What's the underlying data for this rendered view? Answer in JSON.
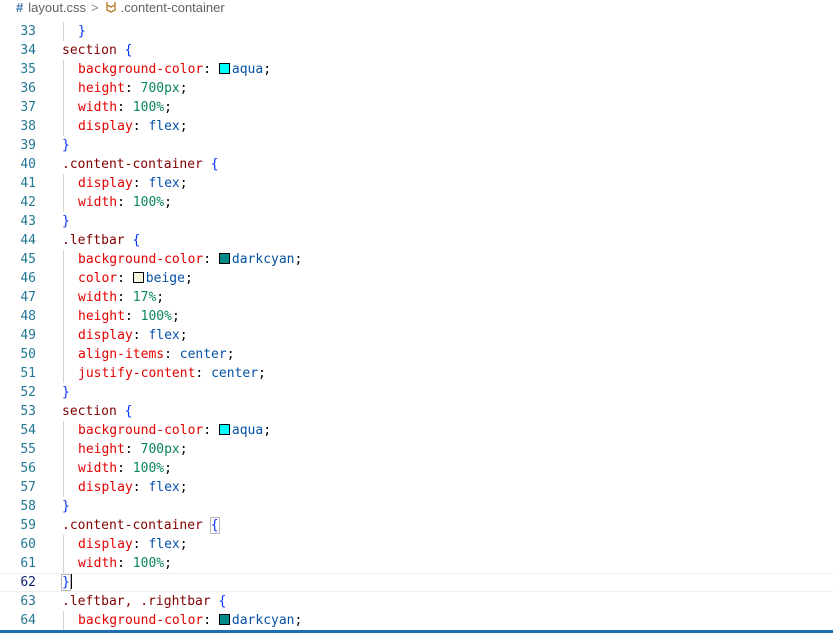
{
  "breadcrumb": {
    "file_icon": "#",
    "file_name": "layout.css",
    "separator": ">",
    "selector_icon": "css-selector-icon",
    "selector": ".content-container"
  },
  "editor": {
    "current_line": "62",
    "lines": [
      {
        "num": "33",
        "tokens": [
          {
            "t": "}",
            "c": "brace"
          }
        ],
        "indent": 1
      },
      {
        "num": "34",
        "tokens": [
          {
            "t": "section",
            "c": "sel"
          },
          {
            "t": " ",
            "c": "punct"
          },
          {
            "t": "{",
            "c": "brace"
          }
        ],
        "indent": 0
      },
      {
        "num": "35",
        "tokens": [
          {
            "t": "background-color",
            "c": "prop"
          },
          {
            "t": ": ",
            "c": "punct"
          },
          {
            "swatch": "#00ffff"
          },
          {
            "t": "aqua",
            "c": "val"
          },
          {
            "t": ";",
            "c": "punct"
          }
        ],
        "indent": 1
      },
      {
        "num": "36",
        "tokens": [
          {
            "t": "height",
            "c": "prop"
          },
          {
            "t": ": ",
            "c": "punct"
          },
          {
            "t": "700px",
            "c": "num"
          },
          {
            "t": ";",
            "c": "punct"
          }
        ],
        "indent": 1
      },
      {
        "num": "37",
        "tokens": [
          {
            "t": "width",
            "c": "prop"
          },
          {
            "t": ": ",
            "c": "punct"
          },
          {
            "t": "100%",
            "c": "num"
          },
          {
            "t": ";",
            "c": "punct"
          }
        ],
        "indent": 1
      },
      {
        "num": "38",
        "tokens": [
          {
            "t": "display",
            "c": "prop"
          },
          {
            "t": ": ",
            "c": "punct"
          },
          {
            "t": "flex",
            "c": "val"
          },
          {
            "t": ";",
            "c": "punct"
          }
        ],
        "indent": 1
      },
      {
        "num": "39",
        "tokens": [
          {
            "t": "}",
            "c": "brace"
          }
        ],
        "indent": 0
      },
      {
        "num": "40",
        "tokens": [
          {
            "t": ".content-container",
            "c": "sel"
          },
          {
            "t": " ",
            "c": "punct"
          },
          {
            "t": "{",
            "c": "brace"
          }
        ],
        "indent": 0
      },
      {
        "num": "41",
        "tokens": [
          {
            "t": "display",
            "c": "prop"
          },
          {
            "t": ": ",
            "c": "punct"
          },
          {
            "t": "flex",
            "c": "val"
          },
          {
            "t": ";",
            "c": "punct"
          }
        ],
        "indent": 1
      },
      {
        "num": "42",
        "tokens": [
          {
            "t": "width",
            "c": "prop"
          },
          {
            "t": ": ",
            "c": "punct"
          },
          {
            "t": "100%",
            "c": "num"
          },
          {
            "t": ";",
            "c": "punct"
          }
        ],
        "indent": 1
      },
      {
        "num": "43",
        "tokens": [
          {
            "t": "}",
            "c": "brace"
          }
        ],
        "indent": 0
      },
      {
        "num": "44",
        "tokens": [
          {
            "t": ".leftbar",
            "c": "sel"
          },
          {
            "t": " ",
            "c": "punct"
          },
          {
            "t": "{",
            "c": "brace"
          }
        ],
        "indent": 0
      },
      {
        "num": "45",
        "tokens": [
          {
            "t": "background-color",
            "c": "prop"
          },
          {
            "t": ": ",
            "c": "punct"
          },
          {
            "swatch": "#008b8b"
          },
          {
            "t": "darkcyan",
            "c": "val"
          },
          {
            "t": ";",
            "c": "punct"
          }
        ],
        "indent": 1
      },
      {
        "num": "46",
        "tokens": [
          {
            "t": "color",
            "c": "prop"
          },
          {
            "t": ": ",
            "c": "punct"
          },
          {
            "swatch": "#f5f5dc"
          },
          {
            "t": "beige",
            "c": "val"
          },
          {
            "t": ";",
            "c": "punct"
          }
        ],
        "indent": 1
      },
      {
        "num": "47",
        "tokens": [
          {
            "t": "width",
            "c": "prop"
          },
          {
            "t": ": ",
            "c": "punct"
          },
          {
            "t": "17%",
            "c": "num"
          },
          {
            "t": ";",
            "c": "punct"
          }
        ],
        "indent": 1
      },
      {
        "num": "48",
        "tokens": [
          {
            "t": "height",
            "c": "prop"
          },
          {
            "t": ": ",
            "c": "punct"
          },
          {
            "t": "100%",
            "c": "num"
          },
          {
            "t": ";",
            "c": "punct"
          }
        ],
        "indent": 1
      },
      {
        "num": "49",
        "tokens": [
          {
            "t": "display",
            "c": "prop"
          },
          {
            "t": ": ",
            "c": "punct"
          },
          {
            "t": "flex",
            "c": "val"
          },
          {
            "t": ";",
            "c": "punct"
          }
        ],
        "indent": 1
      },
      {
        "num": "50",
        "tokens": [
          {
            "t": "align-items",
            "c": "prop"
          },
          {
            "t": ": ",
            "c": "punct"
          },
          {
            "t": "center",
            "c": "val"
          },
          {
            "t": ";",
            "c": "punct"
          }
        ],
        "indent": 1
      },
      {
        "num": "51",
        "tokens": [
          {
            "t": "justify-content",
            "c": "prop"
          },
          {
            "t": ": ",
            "c": "punct"
          },
          {
            "t": "center",
            "c": "val"
          },
          {
            "t": ";",
            "c": "punct"
          }
        ],
        "indent": 1
      },
      {
        "num": "52",
        "tokens": [
          {
            "t": "}",
            "c": "brace"
          }
        ],
        "indent": 0
      },
      {
        "num": "53",
        "tokens": [
          {
            "t": "section",
            "c": "sel"
          },
          {
            "t": " ",
            "c": "punct"
          },
          {
            "t": "{",
            "c": "brace"
          }
        ],
        "indent": 0
      },
      {
        "num": "54",
        "tokens": [
          {
            "t": "background-color",
            "c": "prop"
          },
          {
            "t": ": ",
            "c": "punct"
          },
          {
            "swatch": "#00ffff"
          },
          {
            "t": "aqua",
            "c": "val"
          },
          {
            "t": ";",
            "c": "punct"
          }
        ],
        "indent": 1
      },
      {
        "num": "55",
        "tokens": [
          {
            "t": "height",
            "c": "prop"
          },
          {
            "t": ": ",
            "c": "punct"
          },
          {
            "t": "700px",
            "c": "num"
          },
          {
            "t": ";",
            "c": "punct"
          }
        ],
        "indent": 1
      },
      {
        "num": "56",
        "tokens": [
          {
            "t": "width",
            "c": "prop"
          },
          {
            "t": ": ",
            "c": "punct"
          },
          {
            "t": "100%",
            "c": "num"
          },
          {
            "t": ";",
            "c": "punct"
          }
        ],
        "indent": 1
      },
      {
        "num": "57",
        "tokens": [
          {
            "t": "display",
            "c": "prop"
          },
          {
            "t": ": ",
            "c": "punct"
          },
          {
            "t": "flex",
            "c": "val"
          },
          {
            "t": ";",
            "c": "punct"
          }
        ],
        "indent": 1
      },
      {
        "num": "58",
        "tokens": [
          {
            "t": "}",
            "c": "brace"
          }
        ],
        "indent": 0
      },
      {
        "num": "59",
        "tokens": [
          {
            "t": ".content-container",
            "c": "sel"
          },
          {
            "t": " ",
            "c": "punct"
          },
          {
            "t": "{",
            "c": "brace",
            "match": true
          }
        ],
        "indent": 0
      },
      {
        "num": "60",
        "tokens": [
          {
            "t": "display",
            "c": "prop"
          },
          {
            "t": ": ",
            "c": "punct"
          },
          {
            "t": "flex",
            "c": "val"
          },
          {
            "t": ";",
            "c": "punct"
          }
        ],
        "indent": 1
      },
      {
        "num": "61",
        "tokens": [
          {
            "t": "width",
            "c": "prop"
          },
          {
            "t": ": ",
            "c": "punct"
          },
          {
            "t": "100%",
            "c": "num"
          },
          {
            "t": ";",
            "c": "punct"
          }
        ],
        "indent": 1
      },
      {
        "num": "62",
        "tokens": [
          {
            "t": "}",
            "c": "brace",
            "match": true
          },
          {
            "cursor": true
          }
        ],
        "indent": 0
      },
      {
        "num": "63",
        "tokens": [
          {
            "t": ".leftbar, .rightbar",
            "c": "sel"
          },
          {
            "t": " ",
            "c": "punct"
          },
          {
            "t": "{",
            "c": "brace"
          }
        ],
        "indent": 0
      },
      {
        "num": "64",
        "tokens": [
          {
            "t": "background-color",
            "c": "prop"
          },
          {
            "t": ": ",
            "c": "punct"
          },
          {
            "swatch": "#008b8b"
          },
          {
            "t": "darkcyan",
            "c": "val"
          },
          {
            "t": ";",
            "c": "punct"
          }
        ],
        "indent": 1
      }
    ]
  }
}
